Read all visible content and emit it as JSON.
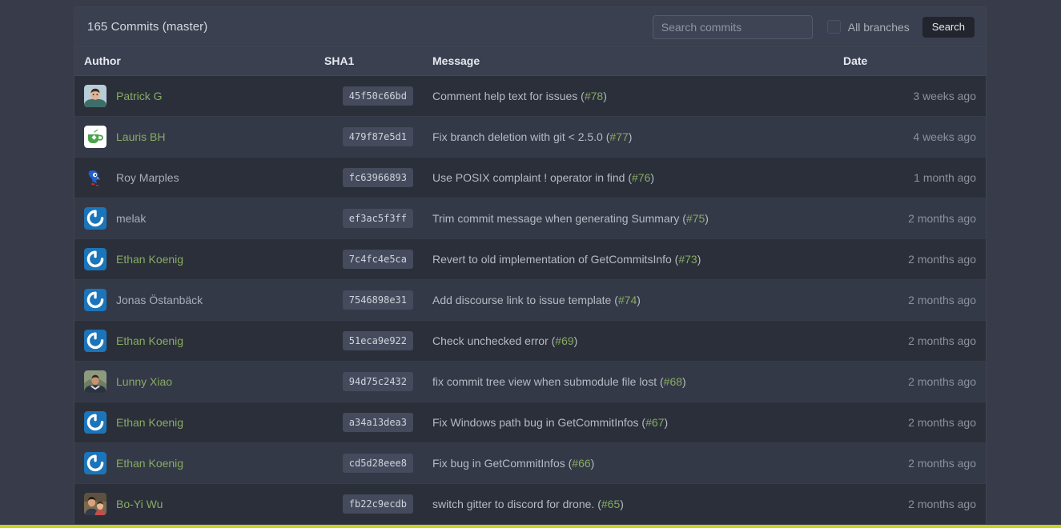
{
  "header": {
    "title": "165 Commits (master)",
    "search": {
      "value": "",
      "placeholder": "Search commits"
    },
    "all_branches_label": "All branches",
    "all_branches_checked": false,
    "search_button_label": "Search"
  },
  "colors": {
    "page_background": "#383c4a",
    "panel_background": "#2e323e",
    "panel_header": "#3b4050",
    "row_odd": "#2b2f3a",
    "row_even": "#343947",
    "link_green": "#87ab63",
    "sha_badge": "#454b5c",
    "bottom_rule": "#c5d221",
    "search_button": "#22252d"
  },
  "table": {
    "columns": [
      "Author",
      "SHA1",
      "Message",
      "Date"
    ],
    "rows": [
      {
        "author": "Patrick G",
        "author_is_link": true,
        "avatar": "photo-man-avatar",
        "sha": "45f50c66bd",
        "message_text": "Comment help text for issues (",
        "message_ref": "#78",
        "message_tail": ")",
        "date": "3 weeks ago"
      },
      {
        "author": "Lauris BH",
        "author_is_link": true,
        "avatar": "green-teacup-avatar",
        "sha": "479f87e5d1",
        "message_text": "Fix branch deletion with git < 2.5.0 (",
        "message_ref": "#77",
        "message_tail": ")",
        "date": "4 weeks ago"
      },
      {
        "author": "Roy Marples",
        "author_is_link": false,
        "avatar": "sonic-sprite-avatar",
        "sha": "fc63966893",
        "message_text": "Use POSIX complaint ! operator in find (",
        "message_ref": "#76",
        "message_tail": ")",
        "date": "1 month ago"
      },
      {
        "author": "melak",
        "author_is_link": false,
        "avatar": "gravatar-default-avatar",
        "sha": "ef3ac5f3ff",
        "message_text": "Trim commit message when generating Summary (",
        "message_ref": "#75",
        "message_tail": ")",
        "date": "2 months ago"
      },
      {
        "author": "Ethan Koenig",
        "author_is_link": true,
        "avatar": "gravatar-default-avatar",
        "sha": "7c4fc4e5ca",
        "message_text": "Revert to old implementation of GetCommitsInfo (",
        "message_ref": "#73",
        "message_tail": ")",
        "date": "2 months ago"
      },
      {
        "author": "Jonas Östanbäck",
        "author_is_link": false,
        "avatar": "gravatar-default-avatar",
        "sha": "7546898e31",
        "message_text": "Add discourse link to issue template (",
        "message_ref": "#74",
        "message_tail": ")",
        "date": "2 months ago"
      },
      {
        "author": "Ethan Koenig",
        "author_is_link": true,
        "avatar": "gravatar-default-avatar",
        "sha": "51eca9e922",
        "message_text": "Check unchecked error (",
        "message_ref": "#69",
        "message_tail": ")",
        "date": "2 months ago"
      },
      {
        "author": "Lunny Xiao",
        "author_is_link": true,
        "avatar": "photo-man-outdoor-avatar",
        "sha": "94d75c2432",
        "message_text": "fix commit tree view when submodule file lost (",
        "message_ref": "#68",
        "message_tail": ")",
        "date": "2 months ago"
      },
      {
        "author": "Ethan Koenig",
        "author_is_link": true,
        "avatar": "gravatar-default-avatar",
        "sha": "a34a13dea3",
        "message_text": "Fix Windows path bug in GetCommitInfos (",
        "message_ref": "#67",
        "message_tail": ")",
        "date": "2 months ago"
      },
      {
        "author": "Ethan Koenig",
        "author_is_link": true,
        "avatar": "gravatar-default-avatar",
        "sha": "cd5d28eee8",
        "message_text": "Fix bug in GetCommitInfos (",
        "message_ref": "#66",
        "message_tail": ")",
        "date": "2 months ago"
      },
      {
        "author": "Bo-Yi Wu",
        "author_is_link": true,
        "avatar": "photo-family-avatar",
        "sha": "fb22c9ecdb",
        "message_text": "switch gitter to discord for drone. (",
        "message_ref": "#65",
        "message_tail": ")",
        "date": "2 months ago"
      }
    ]
  }
}
